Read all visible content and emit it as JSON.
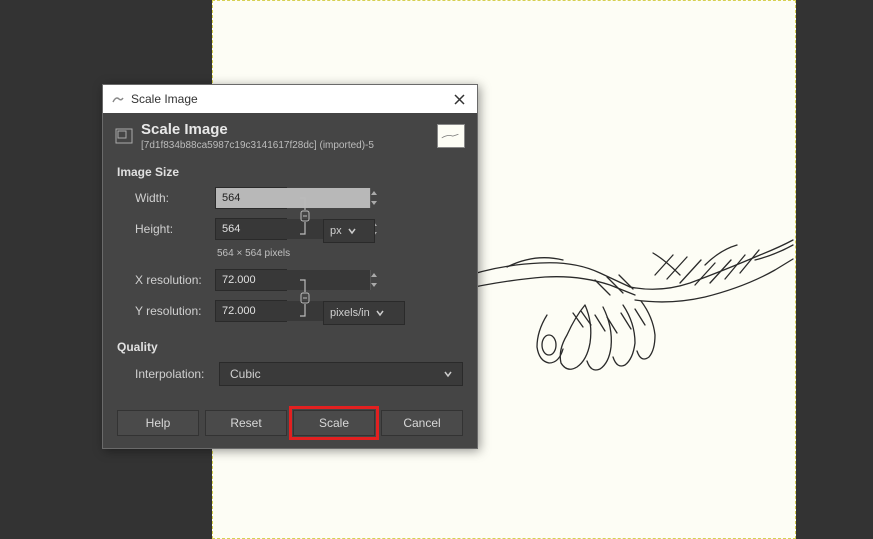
{
  "titlebar": {
    "title": "Scale Image"
  },
  "header": {
    "title": "Scale Image",
    "subtitle": "[7d1f834b88ca5987c19c3141617f28dc] (imported)-5"
  },
  "sections": {
    "image_size": {
      "title": "Image Size",
      "width_label": "Width:",
      "height_label": "Height:",
      "width_value": "564",
      "height_value": "564",
      "dims_text": "564 × 564 pixels",
      "size_unit": "px",
      "xres_label": "X resolution:",
      "yres_label": "Y resolution:",
      "xres_value": "72.000",
      "yres_value": "72.000",
      "res_unit": "pixels/in"
    },
    "quality": {
      "title": "Quality",
      "interp_label": "Interpolation:",
      "interp_value": "Cubic"
    }
  },
  "buttons": {
    "help": "Help",
    "reset": "Reset",
    "scale": "Scale",
    "cancel": "Cancel"
  }
}
